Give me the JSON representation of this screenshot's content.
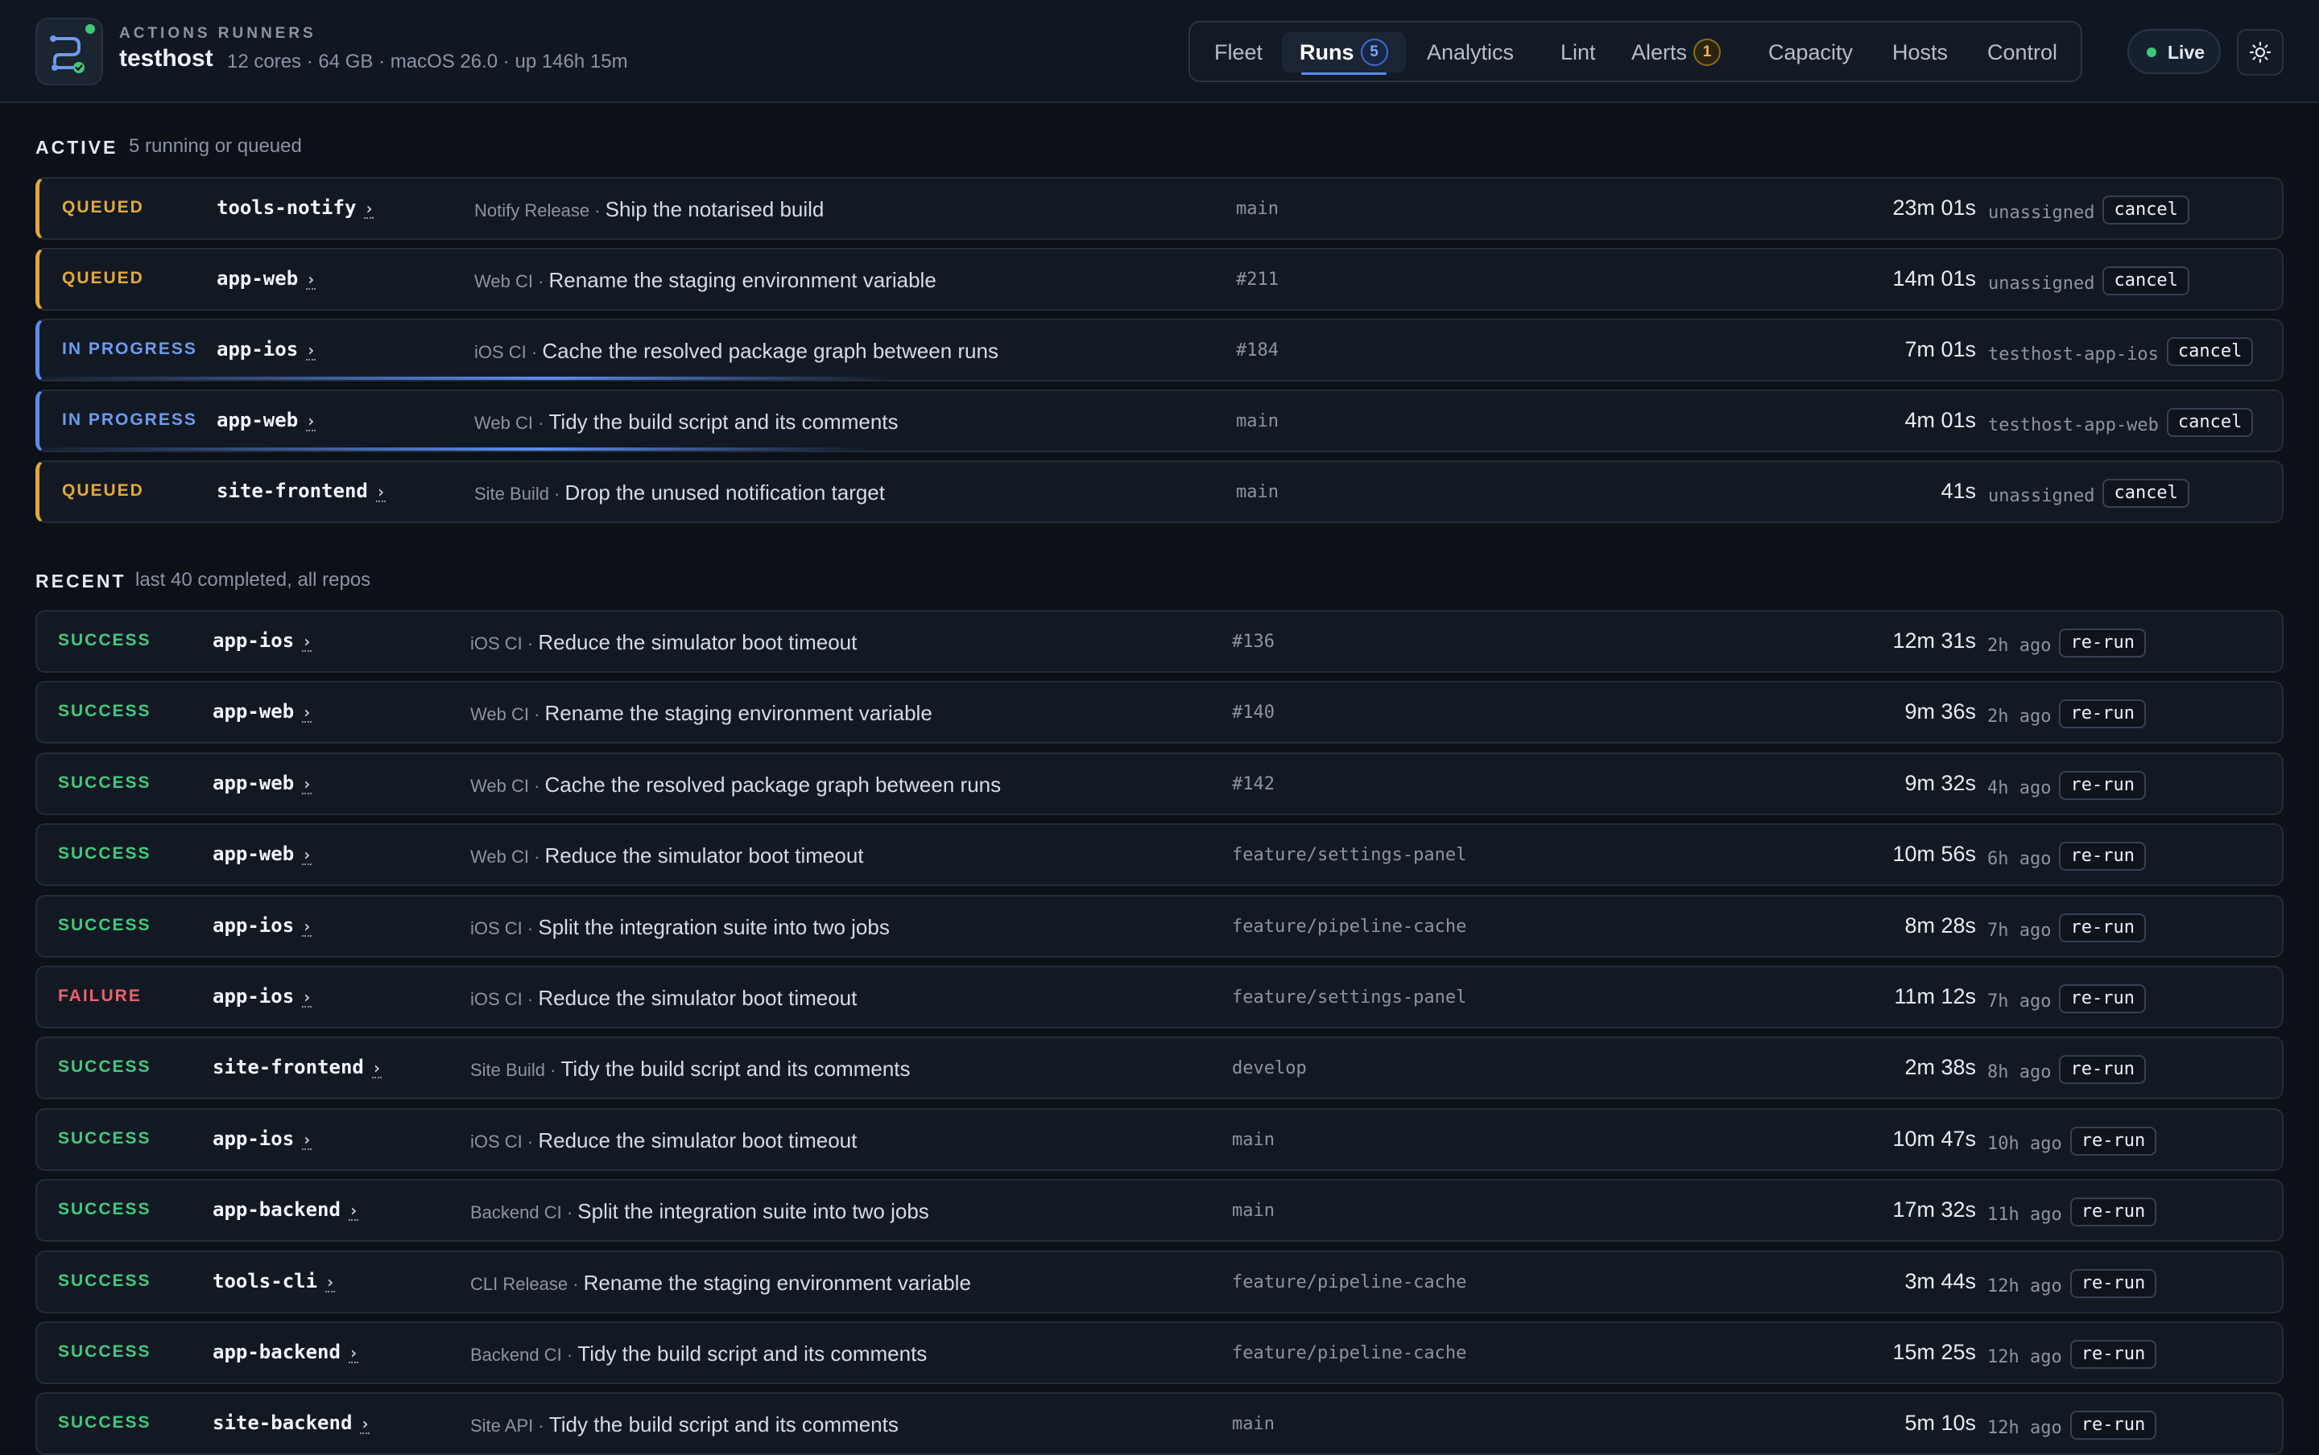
{
  "header": {
    "brand_sub": "ACTIONS RUNNERS",
    "host": "testhost",
    "meta": "12 cores · 64 GB · macOS 26.0 · up 146h 15m",
    "tabs": [
      {
        "label": "Fleet"
      },
      {
        "label": "Runs",
        "badge": "5"
      },
      {
        "label": "Analytics"
      },
      {
        "label": "Lint"
      },
      {
        "label": "Alerts",
        "badge": "1"
      },
      {
        "label": "Capacity"
      },
      {
        "label": "Hosts"
      },
      {
        "label": "Control"
      }
    ],
    "active_tab": "Runs",
    "live_label": "Live"
  },
  "active": {
    "title": "ACTIVE",
    "subtitle": "5 running or queued",
    "rows": [
      {
        "status": "QUEUED",
        "repo": "tools-notify",
        "workflow": "Notify Release",
        "message": "Ship the notarised build",
        "ref": "main",
        "duration": "23m 01s",
        "runner": "unassigned",
        "action": "cancel"
      },
      {
        "status": "QUEUED",
        "repo": "app-web",
        "workflow": "Web CI",
        "message": "Rename the staging environment variable",
        "ref": "#211",
        "duration": "14m 01s",
        "runner": "unassigned",
        "action": "cancel"
      },
      {
        "status": "IN PROGRESS",
        "repo": "app-ios",
        "workflow": "iOS CI",
        "message": "Cache the resolved package graph between runs",
        "ref": "#184",
        "duration": "7m 01s",
        "runner": "testhost-app-ios",
        "action": "cancel",
        "progress": 0.38
      },
      {
        "status": "IN PROGRESS",
        "repo": "app-web",
        "workflow": "Web CI",
        "message": "Tidy the build script and its comments",
        "ref": "main",
        "duration": "4m 01s",
        "runner": "testhost-app-web",
        "action": "cancel",
        "progress": 0.37
      },
      {
        "status": "QUEUED",
        "repo": "site-frontend",
        "workflow": "Site Build",
        "message": "Drop the unused notification target",
        "ref": "main",
        "duration": "41s",
        "runner": "unassigned",
        "action": "cancel"
      }
    ]
  },
  "recent": {
    "title": "RECENT",
    "subtitle": "last 40 completed, all repos",
    "rows": [
      {
        "status": "SUCCESS",
        "repo": "app-ios",
        "workflow": "iOS CI",
        "message": "Reduce the simulator boot timeout",
        "ref": "#136",
        "duration": "12m 31s",
        "ago": "2h ago",
        "action": "re-run"
      },
      {
        "status": "SUCCESS",
        "repo": "app-web",
        "workflow": "Web CI",
        "message": "Rename the staging environment variable",
        "ref": "#140",
        "duration": "9m 36s",
        "ago": "2h ago",
        "action": "re-run"
      },
      {
        "status": "SUCCESS",
        "repo": "app-web",
        "workflow": "Web CI",
        "message": "Cache the resolved package graph between runs",
        "ref": "#142",
        "duration": "9m 32s",
        "ago": "4h ago",
        "action": "re-run"
      },
      {
        "status": "SUCCESS",
        "repo": "app-web",
        "workflow": "Web CI",
        "message": "Reduce the simulator boot timeout",
        "ref": "feature/settings-panel",
        "duration": "10m 56s",
        "ago": "6h ago",
        "action": "re-run"
      },
      {
        "status": "SUCCESS",
        "repo": "app-ios",
        "workflow": "iOS CI",
        "message": "Split the integration suite into two jobs",
        "ref": "feature/pipeline-cache",
        "duration": "8m 28s",
        "ago": "7h ago",
        "action": "re-run"
      },
      {
        "status": "FAILURE",
        "repo": "app-ios",
        "workflow": "iOS CI",
        "message": "Reduce the simulator boot timeout",
        "ref": "feature/settings-panel",
        "duration": "11m 12s",
        "ago": "7h ago",
        "action": "re-run"
      },
      {
        "status": "SUCCESS",
        "repo": "site-frontend",
        "workflow": "Site Build",
        "message": "Tidy the build script and its comments",
        "ref": "develop",
        "duration": "2m 38s",
        "ago": "8h ago",
        "action": "re-run"
      },
      {
        "status": "SUCCESS",
        "repo": "app-ios",
        "workflow": "iOS CI",
        "message": "Reduce the simulator boot timeout",
        "ref": "main",
        "duration": "10m 47s",
        "ago": "10h ago",
        "action": "re-run"
      },
      {
        "status": "SUCCESS",
        "repo": "app-backend",
        "workflow": "Backend CI",
        "message": "Split the integration suite into two jobs",
        "ref": "main",
        "duration": "17m 32s",
        "ago": "11h ago",
        "action": "re-run"
      },
      {
        "status": "SUCCESS",
        "repo": "tools-cli",
        "workflow": "CLI Release",
        "message": "Rename the staging environment variable",
        "ref": "feature/pipeline-cache",
        "duration": "3m 44s",
        "ago": "12h ago",
        "action": "re-run"
      },
      {
        "status": "SUCCESS",
        "repo": "app-backend",
        "workflow": "Backend CI",
        "message": "Tidy the build script and its comments",
        "ref": "feature/pipeline-cache",
        "duration": "15m 25s",
        "ago": "12h ago",
        "action": "re-run"
      },
      {
        "status": "SUCCESS",
        "repo": "site-backend",
        "workflow": "Site API",
        "message": "Tidy the build script and its comments",
        "ref": "main",
        "duration": "5m 10s",
        "ago": "12h ago",
        "action": "re-run"
      }
    ]
  },
  "colors": {
    "queued": "#e4a93a",
    "in_progress": "#6d9bf2",
    "success": "#43c97d",
    "failure": "#f0606a",
    "live": "#3fc77a"
  },
  "icons": {
    "logo": "runner-logo-icon",
    "repo_link": "chevron-right-icon",
    "theme": "sun-icon",
    "live": "status-dot-icon"
  }
}
